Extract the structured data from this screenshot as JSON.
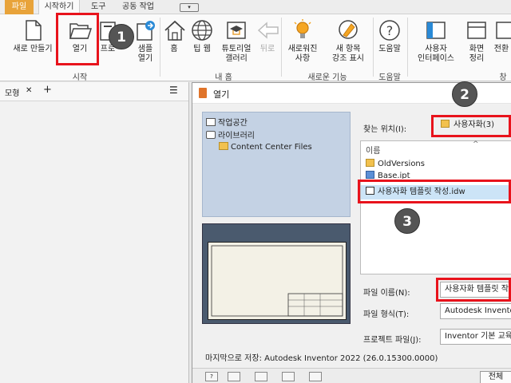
{
  "ribbon": {
    "tabs": {
      "file": "파일",
      "get_started": "시작하기",
      "tools": "도구",
      "collaborate": "공동 작업"
    },
    "buttons": {
      "new": "새로 만들기",
      "open": "열기",
      "projects": "프로",
      "open_samples_1": "샘플",
      "open_samples_2": "열기",
      "home": "홈",
      "tips": "팁 웹",
      "tutorial_1": "튜토리얼",
      "tutorial_2": "갤러리",
      "back": "뒤로",
      "whats_new_1": "새로워진",
      "whats_new_2": "사항",
      "highlight_1": "새 항목",
      "highlight_2": "강조 표시",
      "help": "도움말",
      "ui_1": "사용자",
      "ui_2": "인터페이스",
      "arrange_1": "화면",
      "arrange_2": "정리",
      "switch": "전환"
    },
    "groups": {
      "launch": "시작",
      "my_home": "내 홈",
      "new_features": "새로운 기능",
      "help": "도움말",
      "window": "창"
    }
  },
  "side_panel": {
    "title": "모형",
    "close": "✕",
    "add": "+",
    "menu": "☰"
  },
  "dialog": {
    "title": "열기",
    "project_tree": {
      "workspace": "작업공간",
      "libraries": "라이브러리",
      "content_center": "Content Center Files"
    },
    "look_in_label": "찾는 위치(I):",
    "look_in_value": "사용자화(3)",
    "list_header": "이름",
    "files": [
      "OldVersions",
      "Base.ipt",
      "사용자화 템플릿 작성.idw"
    ],
    "file_name_label": "파일 이름(N):",
    "file_name_value": "사용자화 템플릿 작",
    "file_type_label": "파일 형식(T):",
    "file_type_value": "Autodesk Inventor",
    "project_file_label": "프로젝트 파일(J):",
    "project_file_value": "Inventor 기본 교육",
    "last_saved": "마지막으로 저장: Autodesk Inventor 2022 (26.0.15300.0000)",
    "all_button": "전체"
  },
  "callouts": {
    "step1": "1",
    "step2": "2",
    "step3": "3"
  },
  "colors": {
    "file_tab": "#e8a33a",
    "callout_red": "#e8131c",
    "tree_bg": "#c4d2e4",
    "selection": "#cce4f7"
  }
}
